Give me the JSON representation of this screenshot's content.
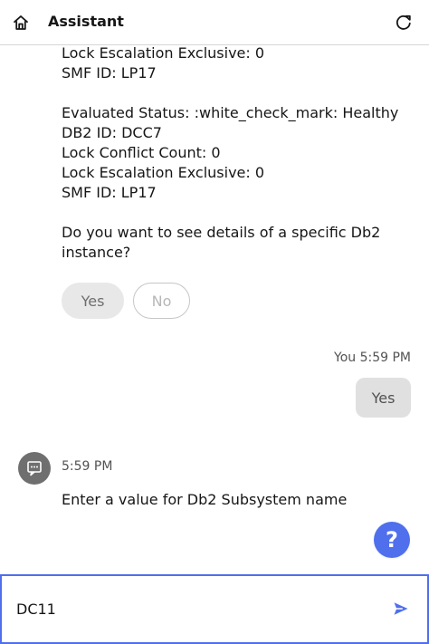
{
  "header": {
    "title": "Assistant",
    "home_icon": "home-icon",
    "refresh_icon": "refresh-icon"
  },
  "bot_message_lines": [
    "Lock Escalation Exclusive: 0",
    "SMF ID: LP17",
    "",
    "Evaluated Status: :white_check_mark: Healthy",
    "DB2 ID: DCC7",
    "Lock Conflict Count: 0",
    "Lock Escalation Exclusive: 0",
    "SMF ID: LP17",
    "",
    "Do you want to see details of a specific Db2",
    "instance?"
  ],
  "choices": {
    "yes": "Yes",
    "no": "No"
  },
  "user_message": {
    "meta": "You 5:59 PM",
    "text": "Yes"
  },
  "bot_followup": {
    "avatar_icon": "chat-assistant-icon",
    "time": "5:59 PM",
    "text": "Enter a value for Db2 Subsystem name"
  },
  "help_button": {
    "label": "?"
  },
  "input": {
    "value": "DC11",
    "send_icon": "send-icon"
  },
  "colors": {
    "accent": "#4f6fec",
    "avatar": "#6f6f6f",
    "bubble": "#e0e0e0",
    "chip": "#e8e8e8"
  }
}
